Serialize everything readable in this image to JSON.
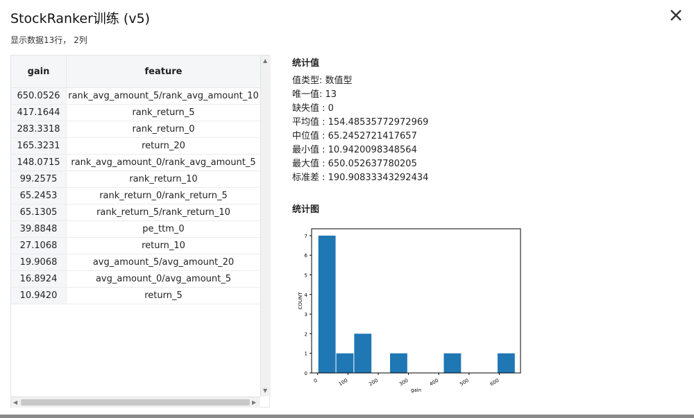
{
  "dialog": {
    "title": "StockRanker训练 (v5)",
    "subtitle": "显示数据13行， 2列"
  },
  "table": {
    "columns": [
      "gain",
      "feature"
    ],
    "rows": [
      {
        "gain": "650.0526",
        "feature": "rank_avg_amount_5/rank_avg_amount_10"
      },
      {
        "gain": "417.1644",
        "feature": "rank_return_5"
      },
      {
        "gain": "283.3318",
        "feature": "rank_return_0"
      },
      {
        "gain": "165.3231",
        "feature": "return_20"
      },
      {
        "gain": "148.0715",
        "feature": "rank_avg_amount_0/rank_avg_amount_5"
      },
      {
        "gain": "99.2575",
        "feature": "rank_return_10"
      },
      {
        "gain": "65.2453",
        "feature": "rank_return_0/rank_return_5"
      },
      {
        "gain": "65.1305",
        "feature": "rank_return_5/rank_return_10"
      },
      {
        "gain": "39.8848",
        "feature": "pe_ttm_0"
      },
      {
        "gain": "27.1068",
        "feature": "return_10"
      },
      {
        "gain": "19.9068",
        "feature": "avg_amount_5/avg_amount_20"
      },
      {
        "gain": "16.8924",
        "feature": "avg_amount_0/avg_amount_5"
      },
      {
        "gain": "10.9420",
        "feature": "return_5"
      }
    ]
  },
  "stats": {
    "heading": "统计值",
    "lines": [
      "值类型: 数值型",
      "唯一值: 13",
      "缺失值 : 0",
      "平均值 : 154.48535772972969",
      "中位值 : 65.2452721417657",
      "最小值 : 10.9420098348564",
      "最大值 : 650.052637780205",
      "标准差 : 190.90833343292434"
    ]
  },
  "chart_heading": "统计图",
  "chart_data": {
    "type": "bar",
    "bins": [
      {
        "start": 0,
        "end": 59.2,
        "count": 7
      },
      {
        "start": 59.2,
        "end": 118.4,
        "count": 1
      },
      {
        "start": 118.4,
        "end": 177.6,
        "count": 2
      },
      {
        "start": 236.8,
        "end": 296.0,
        "count": 1
      },
      {
        "start": 414.4,
        "end": 473.6,
        "count": 1
      },
      {
        "start": 592.0,
        "end": 651.2,
        "count": 1
      }
    ],
    "xlabel": "gain",
    "ylabel": "COUNT",
    "xticks": [
      0,
      100,
      200,
      300,
      400,
      500,
      600
    ],
    "yticks": [
      0,
      1,
      2,
      3,
      4,
      5,
      6,
      7
    ],
    "xlim": [
      -20,
      670
    ],
    "ylim": [
      0,
      7.35
    ],
    "bar_color": "#1f77b4"
  }
}
